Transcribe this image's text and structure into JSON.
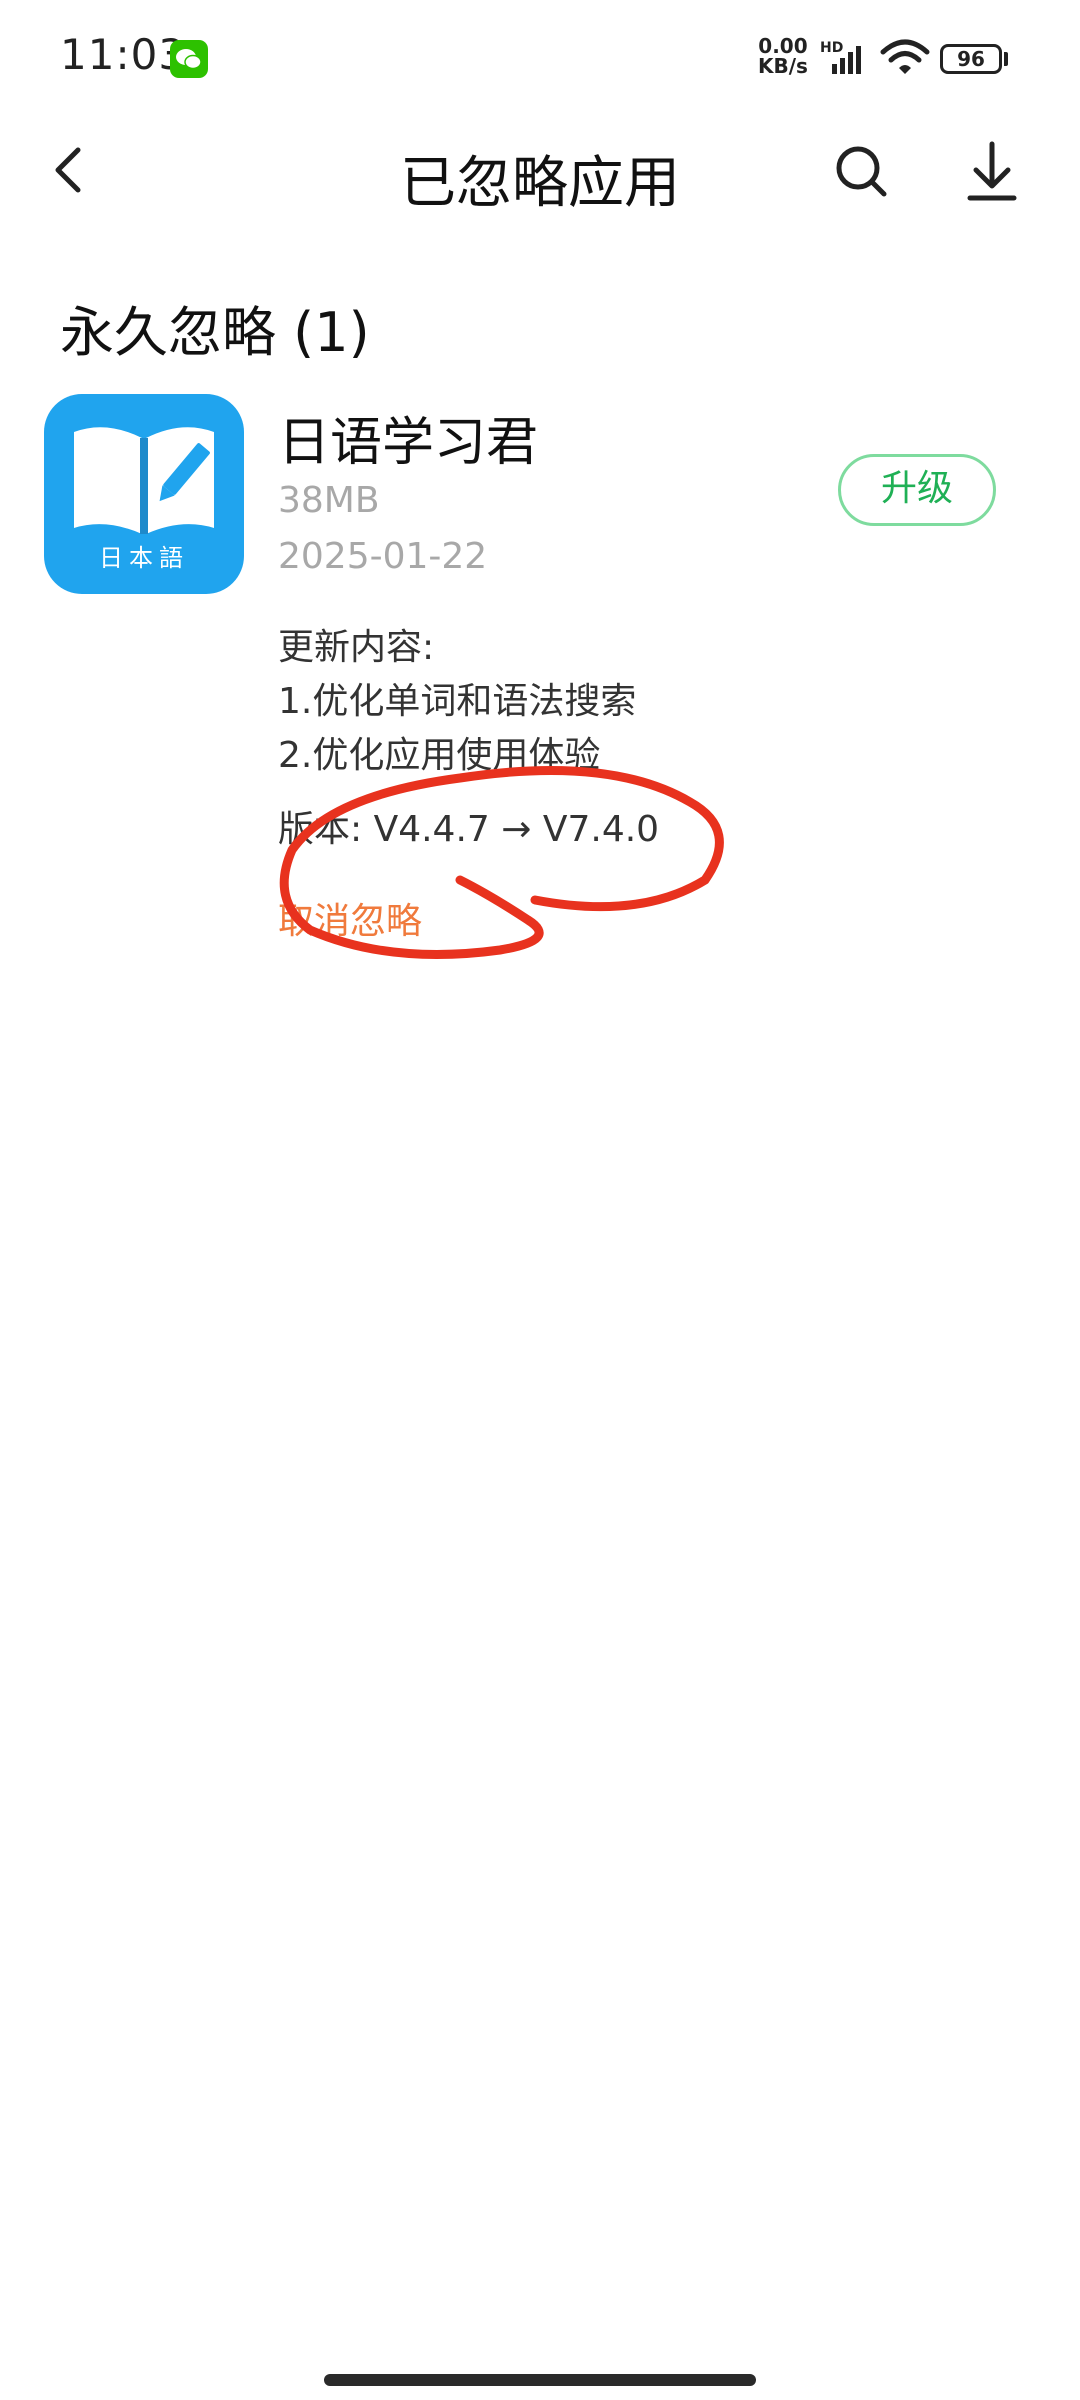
{
  "status_bar": {
    "time": "11:03",
    "net_speed_value": "0.00",
    "net_speed_unit": "KB/s",
    "network_type": "HD",
    "battery": "96",
    "notification_app_icon": "wechat-icon"
  },
  "header": {
    "title": "已忽略应用",
    "icons": [
      "back-arrow-icon",
      "search-icon",
      "download-icon"
    ]
  },
  "section": {
    "title": "永久忽略 (1)"
  },
  "app": {
    "name": "日语学习君",
    "size": "38MB",
    "date": "2025-01-22",
    "icon_label": "日本語",
    "upgrade_label": "升级",
    "changelog_title": "更新内容:",
    "changelog_lines": [
      "1.优化单词和语法搜索",
      "2.优化应用使用体验"
    ],
    "version_text": "版本: V4.4.7 → V7.4.0",
    "unignore_label": "取消忽略"
  },
  "colors": {
    "accent_green": "#1FB055",
    "link_orange": "#F07A3C",
    "secondary_text": "#A8A8A8",
    "app_icon_blue": "#20A4EE",
    "annotation_red": "#E8321E"
  }
}
